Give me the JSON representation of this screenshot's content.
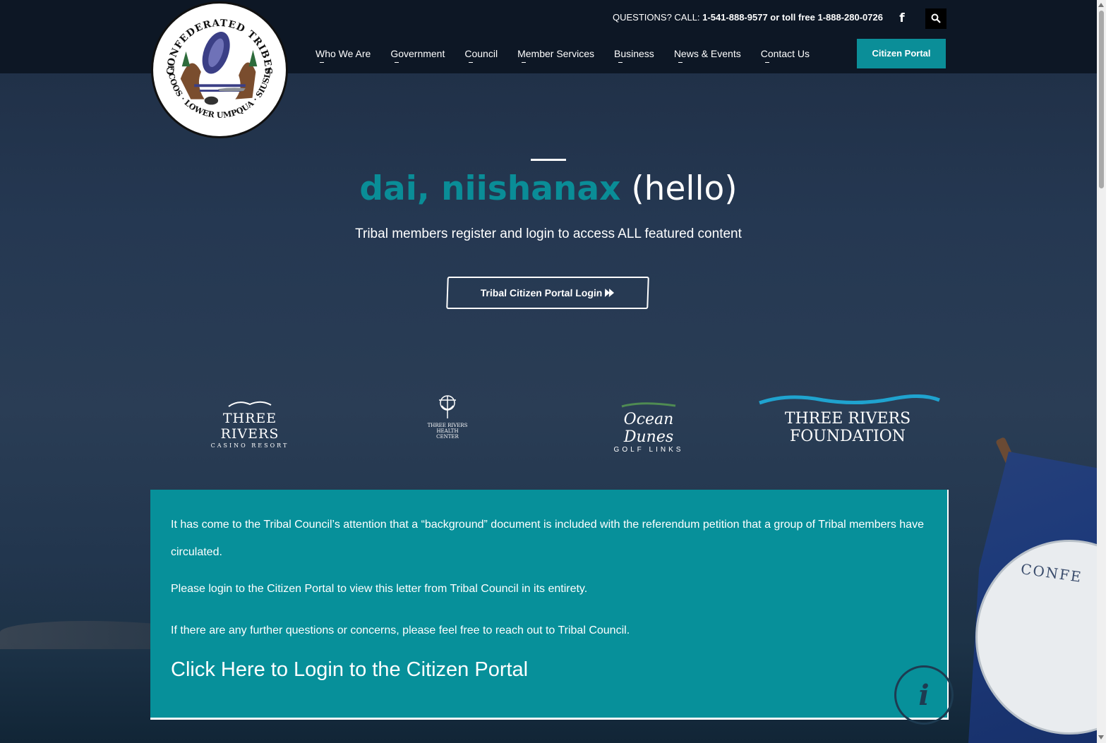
{
  "header": {
    "logo_text_top": "CONFEDERATED TRIBES",
    "logo_text_bottom": "OF COOS · LOWER UMPQUA · SIUSLAW",
    "questions_prefix": "QUESTIONS? CALL: ",
    "questions_numbers": "1-541-888-9577 or toll free 1-888-280-0726",
    "facebook_icon": "facebook-icon",
    "search_icon": "search-icon",
    "nav": [
      "Who We Are",
      "Government",
      "Council",
      "Member Services",
      "Business",
      "News & Events",
      "Contact Us"
    ],
    "portal_button": "Citizen Portal"
  },
  "hero": {
    "title_teal": "dai, niishanax",
    "title_white": " (hello)",
    "subtitle": "Tribal members register and login to access ALL featured content",
    "button_label": "Tribal Citizen Portal Login",
    "button_icon": "double-chevron-right-icon"
  },
  "partners": {
    "three_rivers": {
      "name": "THREE RIVERS",
      "sub": "CASINO RESORT"
    },
    "health": {
      "name": "THREE RIVERS",
      "sub": "HEALTH CENTER"
    },
    "ocean_dunes": {
      "name": "Ocean Dunes",
      "sub": "GOLF LINKS"
    },
    "foundation": {
      "name": "THREE RIVERS FOUNDATION"
    }
  },
  "notice": {
    "p1": "It has come to the Tribal Council’s attention that a “background” document is included with the referendum petition that a group of Tribal members have circulated.",
    "p2": "Please login to the Citizen Portal to view this letter from Tribal Council in its entirety.",
    "p3": "If there are any further questions or concerns, please feel free to reach out to Tribal Council.",
    "link": "Click Here to Login to the Citizen Portal"
  },
  "background_flag_text": "CONFE",
  "info_icon": "i",
  "colors": {
    "teal": "#0a8d97",
    "header_bg": "#0d1725",
    "notice_bg": "#07909a"
  }
}
